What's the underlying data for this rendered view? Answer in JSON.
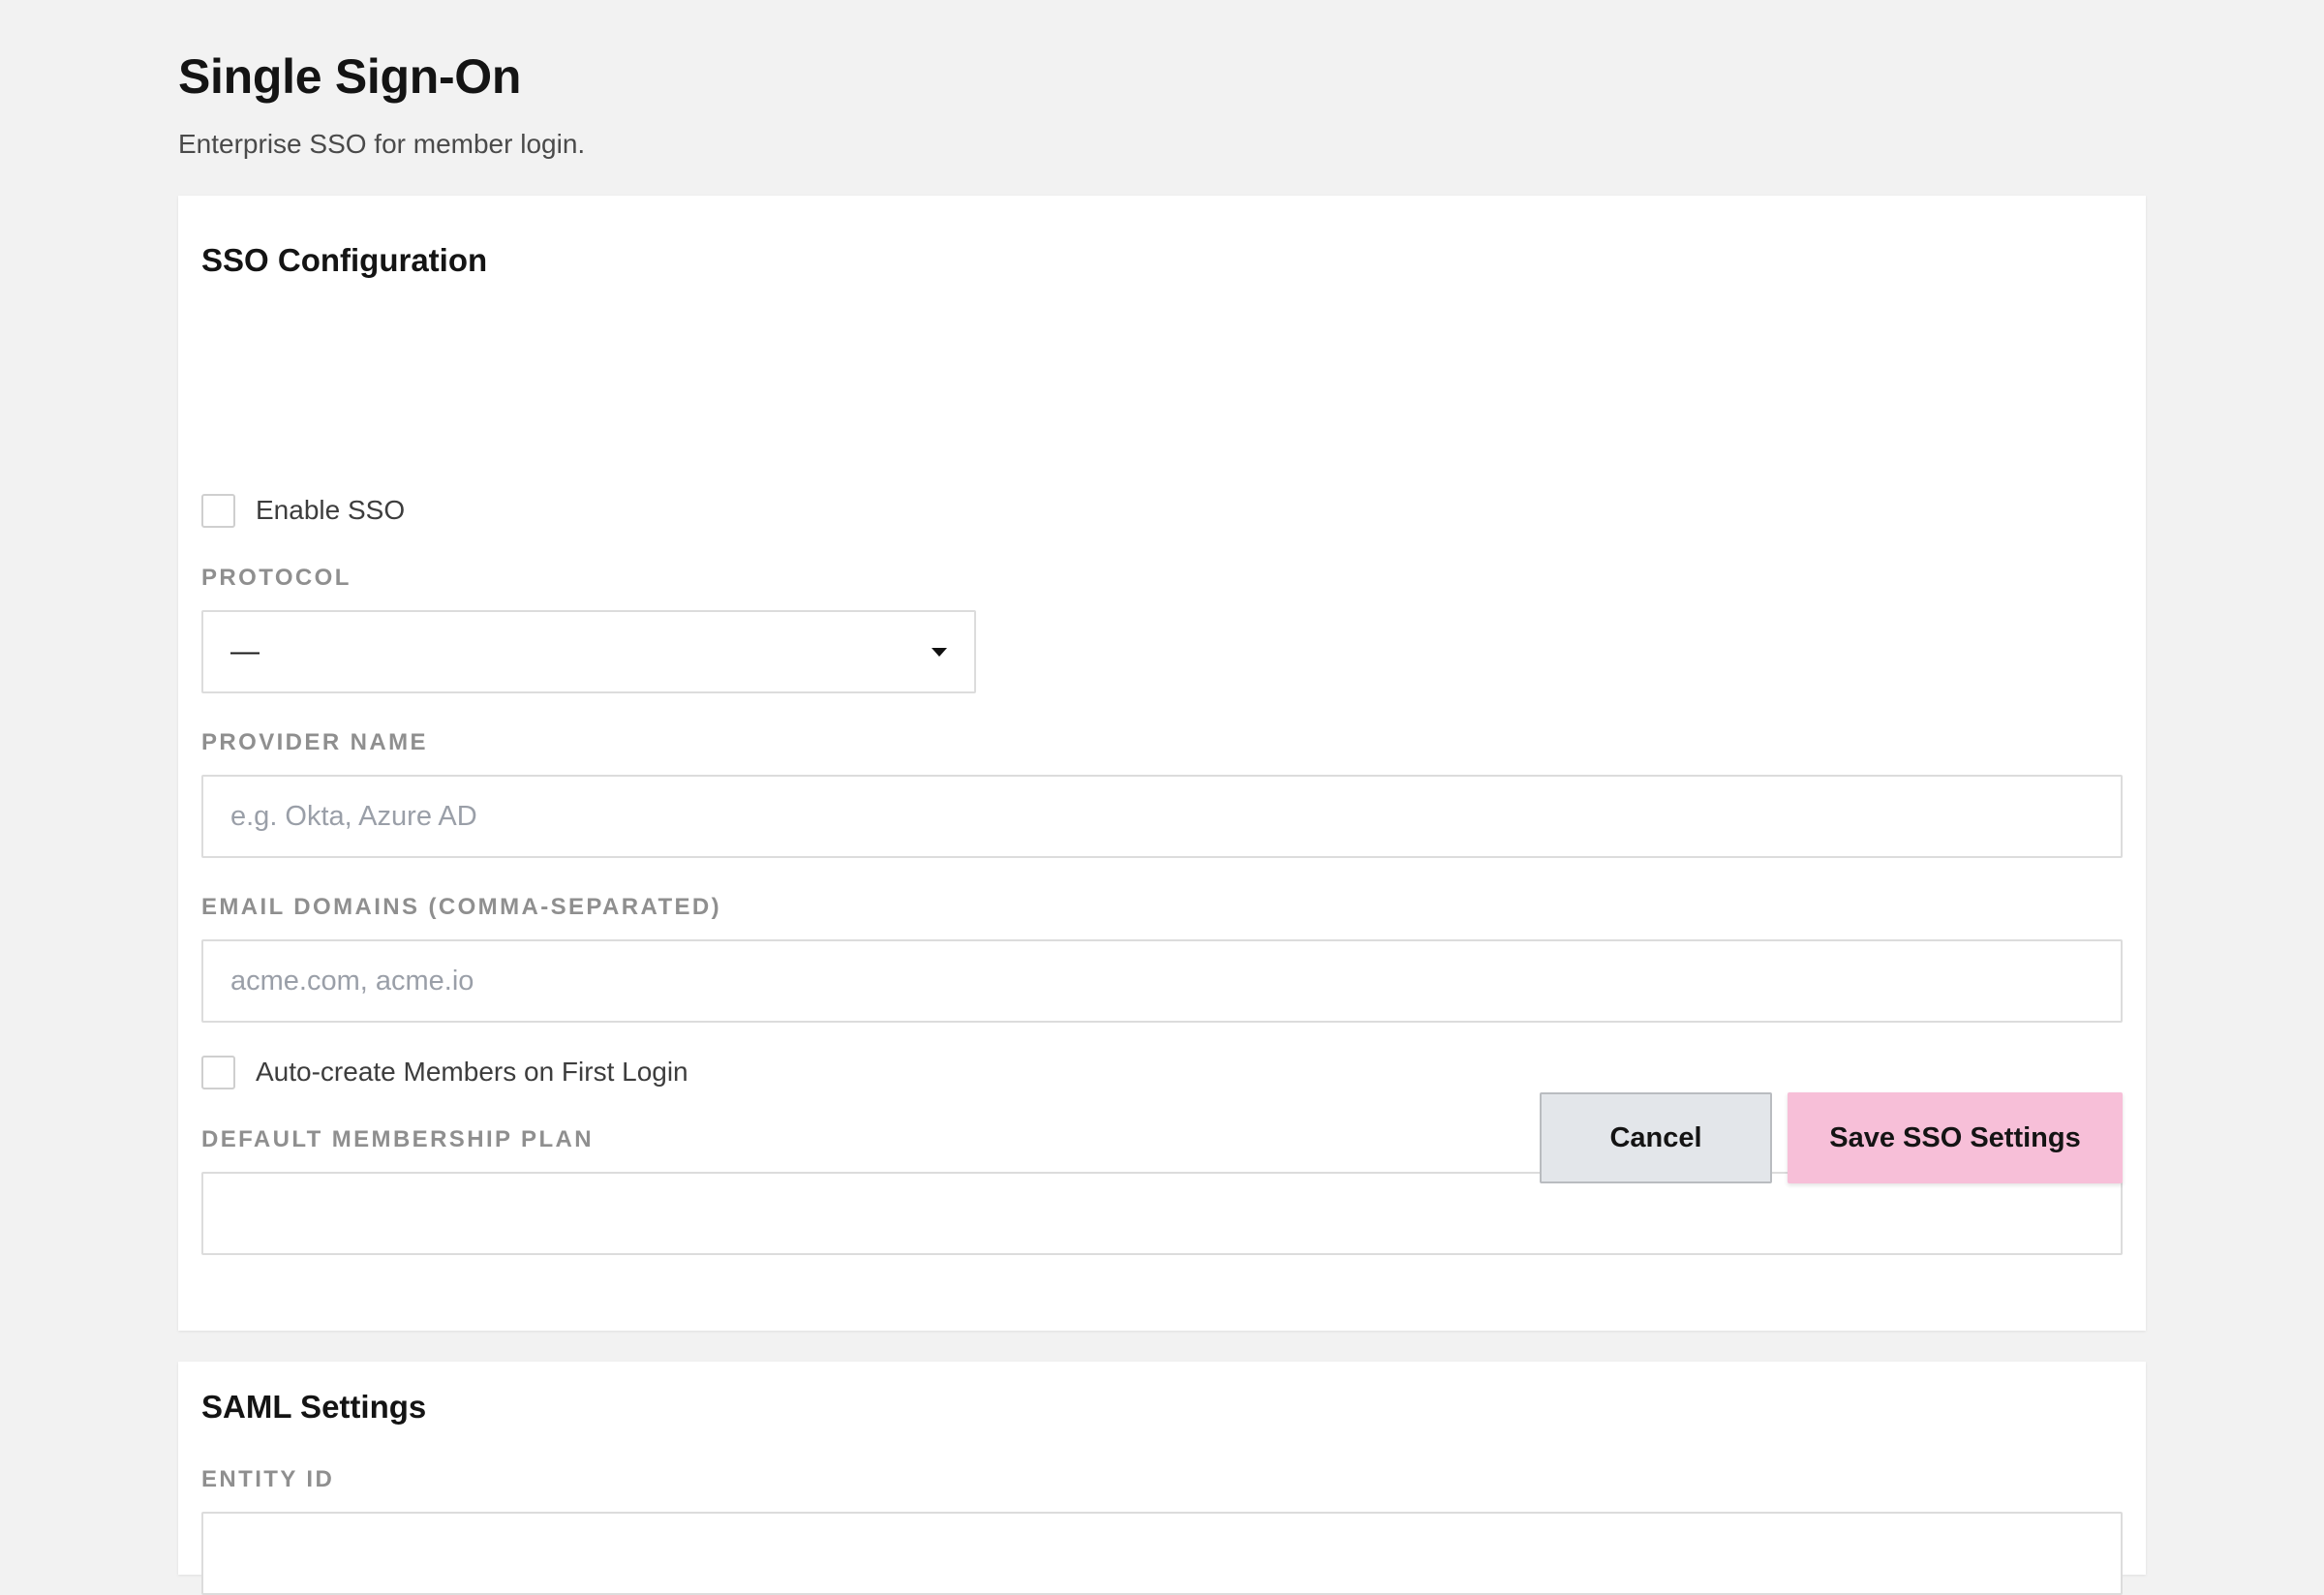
{
  "header": {
    "title": "Single Sign-On",
    "subtitle": "Enterprise SSO for member login."
  },
  "sso_config": {
    "title": "SSO Configuration",
    "enable_sso_label": "Enable SSO",
    "enable_sso_checked": false,
    "protocol_label": "PROTOCOL",
    "protocol_value": "—",
    "provider_name_label": "PROVIDER NAME",
    "provider_name_value": "",
    "provider_name_placeholder": "e.g. Okta, Azure AD",
    "email_domains_label": "EMAIL DOMAINS (COMMA-SEPARATED)",
    "email_domains_value": "",
    "email_domains_placeholder": "acme.com, acme.io",
    "auto_create_label": "Auto-create Members on First Login",
    "auto_create_checked": false,
    "default_plan_label": "DEFAULT MEMBERSHIP PLAN",
    "default_plan_value": "",
    "cancel_label": "Cancel",
    "save_label": "Save SSO Settings"
  },
  "saml_settings": {
    "title": "SAML Settings",
    "entity_id_label": "ENTITY ID"
  },
  "colors": {
    "background": "#f2f2f2",
    "save_button": "#f7bfd8",
    "cancel_button": "#e3e6ea"
  }
}
